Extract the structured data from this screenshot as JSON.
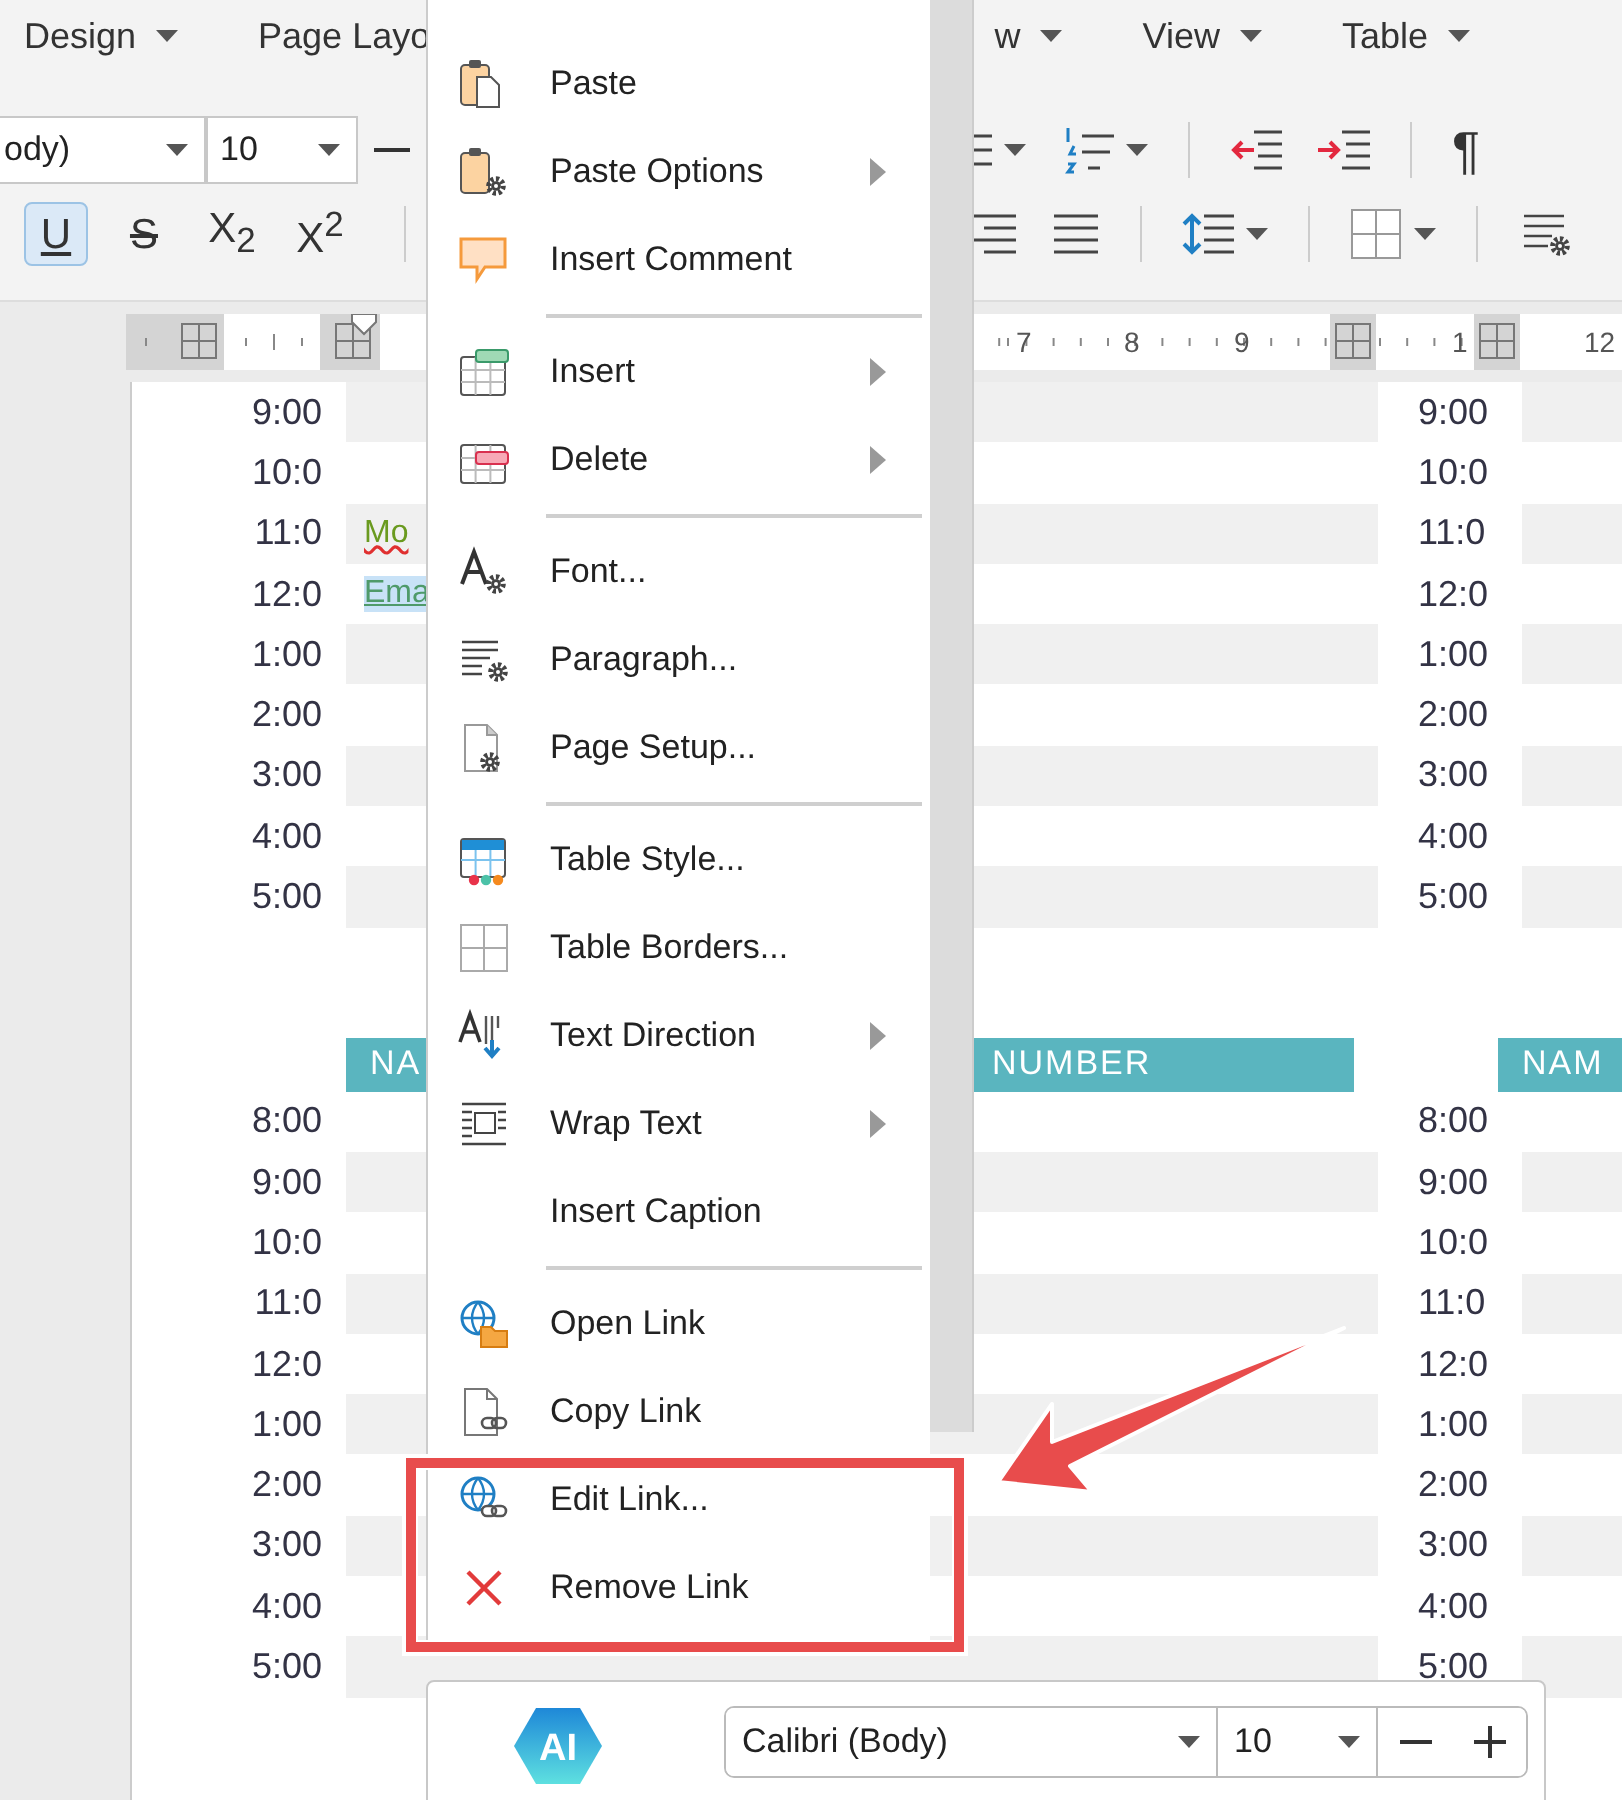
{
  "menu_bar": {
    "left": [
      {
        "label": "Design"
      },
      {
        "label": "Page Layo"
      }
    ],
    "right": [
      {
        "label": "w"
      },
      {
        "label": "View"
      },
      {
        "label": "Table"
      }
    ]
  },
  "toolbar": {
    "font_name": "ody)",
    "font_size": "10",
    "paragraph_mark": "¶",
    "format_buttons": [
      {
        "label": "U",
        "kind": "underline",
        "selected": true
      },
      {
        "label": "S",
        "kind": "strikethrough",
        "selected": false
      },
      {
        "label": "X$_{2}$",
        "kind": "plain",
        "selected": false
      },
      {
        "label": "X$^{2}$",
        "kind": "plain",
        "selected": false
      }
    ]
  },
  "ruler": {
    "labels": [
      "7",
      "8",
      "9",
      "1",
      "12"
    ]
  },
  "document": {
    "blocks": [
      {
        "rows": [
          {
            "time": "9:00",
            "time_right": "9:00",
            "shaded": true
          },
          {
            "time": "10:0",
            "time_right": "10:0",
            "shaded": false
          },
          {
            "time": "11:0",
            "time_right": "11:0",
            "shaded": true,
            "entry": {
              "kind": "misspelled",
              "text": "Mo"
            }
          },
          {
            "time": "12:0",
            "time_right": "12:0",
            "shaded": false,
            "entry": {
              "kind": "selected-link",
              "text": "Ema"
            }
          },
          {
            "time": "1:00",
            "time_right": "1:00",
            "shaded": true
          },
          {
            "time": "2:00",
            "time_right": "2:00",
            "shaded": false
          },
          {
            "time": "3:00",
            "time_right": "3:00",
            "shaded": true
          },
          {
            "time": "4:00",
            "time_right": "4:00",
            "shaded": false
          },
          {
            "time": "5:00",
            "time_right": "5:00",
            "shaded": true
          }
        ]
      },
      {
        "header": [
          "NA",
          "NUMBER",
          "NAM"
        ],
        "rows": [
          {
            "time": "8:00",
            "time_right": "8:00",
            "shaded": false
          },
          {
            "time": "9:00",
            "time_right": "9:00",
            "shaded": true
          },
          {
            "time": "10:0",
            "time_right": "10:0",
            "shaded": false
          },
          {
            "time": "11:0",
            "time_right": "11:0",
            "shaded": true
          },
          {
            "time": "12:0",
            "time_right": "12:0",
            "shaded": false
          },
          {
            "time": "1:00",
            "time_right": "1:00",
            "shaded": true
          },
          {
            "time": "2:00",
            "time_right": "2:00",
            "shaded": false
          },
          {
            "time": "3:00",
            "time_right": "3:00",
            "shaded": true
          },
          {
            "time": "4:00",
            "time_right": "4:00",
            "shaded": false
          },
          {
            "time": "5:00",
            "time_right": "5:00",
            "shaded": true
          }
        ]
      }
    ]
  },
  "context_menu": {
    "sections": [
      {
        "items": [
          {
            "label": "Paste",
            "submenu": false
          },
          {
            "label": "Paste Options",
            "submenu": true
          },
          {
            "label": "Insert Comment",
            "submenu": false
          }
        ]
      },
      {
        "items": [
          {
            "label": "Insert",
            "submenu": true
          },
          {
            "label": "Delete",
            "submenu": true
          }
        ]
      },
      {
        "items": [
          {
            "label": "Font...",
            "submenu": false
          },
          {
            "label": "Paragraph...",
            "submenu": false
          },
          {
            "label": "Page Setup...",
            "submenu": false
          }
        ]
      },
      {
        "items": [
          {
            "label": "Table Style...",
            "submenu": false
          },
          {
            "label": "Table Borders...",
            "submenu": false
          },
          {
            "label": "Text Direction",
            "submenu": true
          },
          {
            "label": "Wrap Text",
            "submenu": true
          },
          {
            "label": "Insert Caption",
            "submenu": false
          }
        ]
      },
      {
        "items": [
          {
            "label": "Open Link",
            "submenu": false
          },
          {
            "label": "Copy Link",
            "submenu": false
          },
          {
            "label": "Edit Link...",
            "submenu": false
          },
          {
            "label": "Remove Link",
            "submenu": false
          }
        ]
      }
    ]
  },
  "mini_toolbar": {
    "logo_text": "AI",
    "font_name": "Calibri (Body)",
    "font_size": "10"
  }
}
